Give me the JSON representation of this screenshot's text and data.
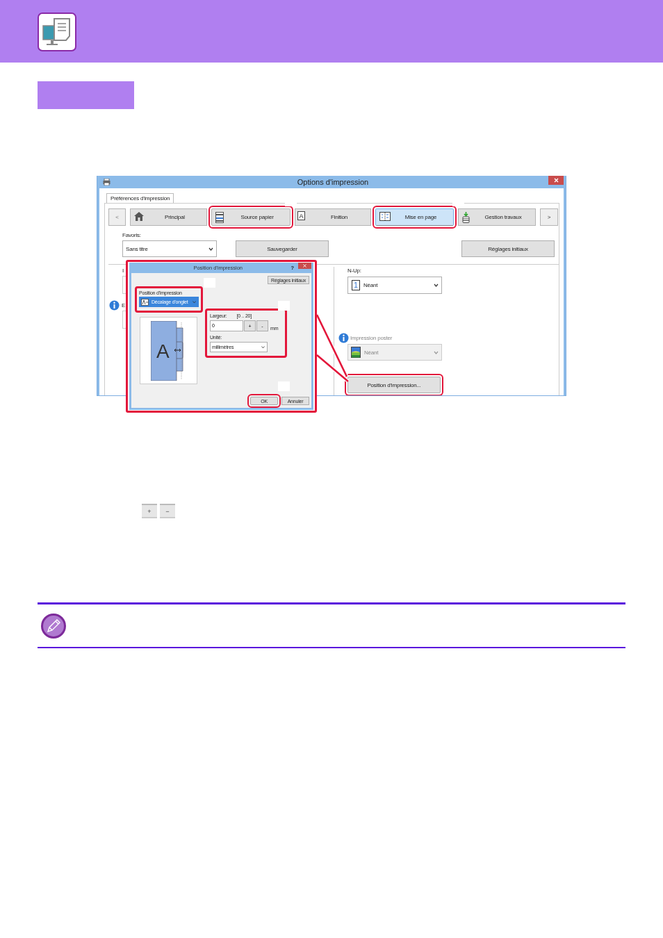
{
  "window": {
    "title": "Options d'impression",
    "tab": "Préférences d'impression",
    "nav_prev": "<",
    "nav_next": ">",
    "categories": [
      {
        "label": "Principal",
        "selected": false,
        "highlighted": false
      },
      {
        "label": "Source papier",
        "selected": false,
        "highlighted": true
      },
      {
        "label": "Finition",
        "selected": false,
        "highlighted": false,
        "icon_text": "A"
      },
      {
        "label": "Mise en page",
        "selected": true,
        "highlighted": true
      },
      {
        "label": "Gestion travaux",
        "selected": false,
        "highlighted": false
      }
    ],
    "favorites": {
      "label": "Favoris:",
      "value": "Sans titre"
    },
    "save_button": "Sauvegarder",
    "reset_button": "Réglages initiaux",
    "left_labels": [
      "I",
      "E"
    ],
    "n_up": {
      "label": "N-Up:",
      "icon_text": "1",
      "value": "Néant"
    },
    "poster": {
      "label": "Impression poster",
      "value": "Néant",
      "disabled": true
    },
    "position_button": {
      "label": "Position d'impression...",
      "highlighted": true
    }
  },
  "dialog": {
    "title": "Position d'impression",
    "help": "?",
    "highlighted": true,
    "reset_button": "Réglages initiaux",
    "position": {
      "label": "Position d'impression",
      "value": "Décalage d'onglet",
      "highlighted": true
    },
    "preview_letter": "A",
    "width": {
      "label": "Largeur:",
      "range": "[0 .. 20]",
      "value": "0",
      "plus": "+",
      "minus": "-",
      "unit": "mm",
      "highlighted": true
    },
    "unit": {
      "label": "Unité:",
      "value": "millimètres"
    },
    "ok_button": {
      "label": "OK",
      "highlighted": true
    },
    "cancel_button": "Annuler"
  },
  "step_buttons": [
    "+",
    "−"
  ]
}
